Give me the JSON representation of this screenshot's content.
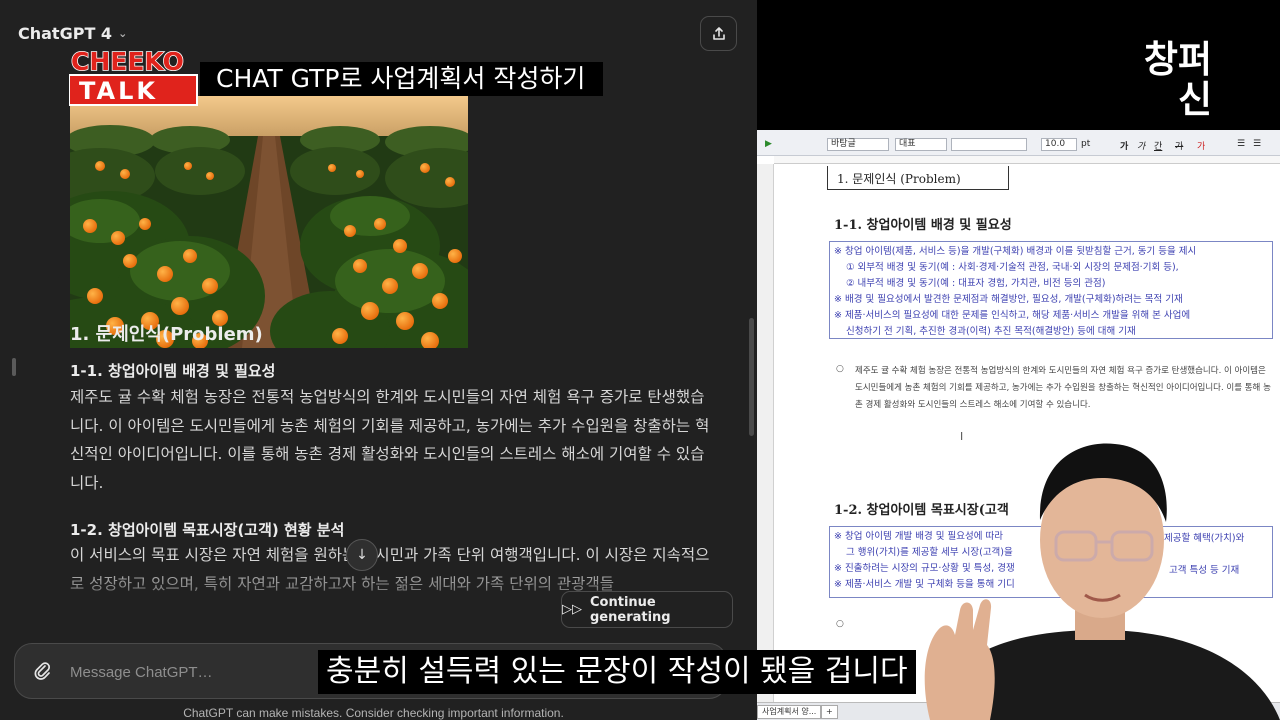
{
  "chat": {
    "model_label": "ChatGPT 4",
    "heading_problem": "1. 문제인식(Problem)",
    "heading_1_1": "1-1. 창업아이템 배경 및 필요성",
    "para_1_1": "제주도 귤 수확 체험 농장은 전통적 농업방식의 한계와 도시민들의 자연 체험 욕구 증가로 탄생했습니다. 이 아이템은 도시민들에게 농촌 체험의 기회를 제공하고, 농가에는 추가 수입원을 창출하는 혁신적인 아이디어입니다. 이를 통해 농촌 경제 활성화와 도시인들의 스트레스 해소에 기여할 수 있습니다.",
    "heading_1_2": "1-2. 창업아이템 목표시장(고객) 현황 분석",
    "para_1_2": "이 서비스의 목표 시장은 자연 체험을 원하는 도시민과 가족 단위 여행객입니다. 이 시장은 지속적으로 성장하고 있으며, 특히 자연과 교감하고자 하는 젊은 세대와 가족 단위의 관광객들",
    "continue_label": "Continue generating",
    "input_placeholder": "Message ChatGPT…",
    "disclaimer": "ChatGPT can make mistakes. Consider checking important information."
  },
  "overlay": {
    "logo_top": "CHEEKO",
    "logo_bottom": "TALK",
    "video_title": "CHAT GTP로 사업계획서 작성하기",
    "corner_logo_line1": "창퍼",
    "corner_logo_line2": "신",
    "subtitle": "충분히 설득력 있는 문장이 작성이 됐을 겁니다"
  },
  "hwp": {
    "toolbar": {
      "style_value": "바탕글",
      "font_kind": "대표",
      "font_size": "10.0",
      "font_unit": "pt",
      "bold": "가",
      "italic": "가",
      "underline": "간",
      "strike": "가",
      "color": "가"
    },
    "section_title": "1. 문제인식 (Problem)",
    "heading_1_1": "1-1. 창업아이템 배경 및 필요성",
    "guide_1": [
      "※ 창업 아이템(제품, 서비스 등)을 개발(구체화) 배경과 이를 뒷받침할 근거, 동기 등을 제시",
      "① 외부적 배경 및 동기(예 : 사회·경제·기술적 관점, 국내·외 시장의 문제점·기회 등),",
      "② 내부적 배경 및 동기(예 : 대표자 경험, 가치관, 비전 등의 관점)",
      "※ 배경 및 필요성에서 발견한 문제점과 해결방안, 필요성, 개발(구체화)하려는 목적 기재",
      "※ 제품·서비스의 필요성에 대한 문제를 인식하고, 해당 제품·서비스 개발을 위해 본 사업에",
      "신청하기 전 기획, 추진한 경과(이력) 추진 목적(해결방안) 등에 대해 기재"
    ],
    "bullet": "○",
    "body_text": "제주도 귤 수확 체험 농장은 전통적 농업방식의 한계와 도시민들의 자연 체험 욕구 증가로 탄생했습니다. 이 아이템은 도시민들에게 농촌 체험의 기회를 제공하고, 농가에는 추가 수입원을 창출하는 혁신적인 아이디어입니다. 이를 통해 농촌 경제 활성화와 도시인들의 스트레스 해소에 기여할 수 있습니다.",
    "heading_1_2": "1-2. 창업아이템 목표시장(고객",
    "guide_2": [
      "※ 창업 아이템 개발 배경 및 필요성에 따라",
      "그 행위(가치)를 제공할 세부 시장(고객)을",
      "※ 진출하려는 시장의 규모·상황 및 특성, 경쟁",
      "※ 제품·서비스 개발 및 구체화 등을 통해 기디"
    ],
    "guide_2_tail": [
      "제공할 혜택(가치)와",
      "",
      "고객 특성 등 기재",
      ""
    ],
    "bullet_2": "○",
    "status_tab": "사업계획서 양...",
    "status_add": "+"
  }
}
